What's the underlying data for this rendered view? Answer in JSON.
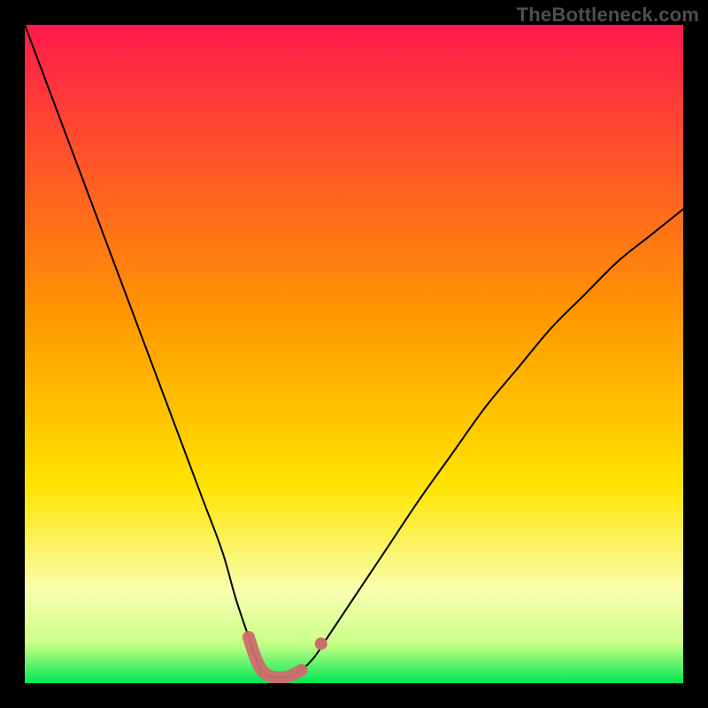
{
  "watermark": "TheBottleneck.com",
  "colors": {
    "frame_bg": "#000000",
    "gradient_top": "#ff1a4b",
    "gradient_mid": "#ffd400",
    "gradient_low": "#f9ffb0",
    "gradient_green": "#00e853",
    "curve_stroke": "#000000",
    "marker_color": "#cf6b6e",
    "watermark_color": "#4e4e4e"
  },
  "chart_data": {
    "type": "line",
    "title": "",
    "xlabel": "",
    "ylabel": "",
    "xlim": [
      0,
      100
    ],
    "ylim": [
      0,
      100
    ],
    "series": [
      {
        "name": "bottleneck-curve",
        "x": [
          0,
          3,
          6,
          9,
          12,
          15,
          18,
          21,
          24,
          27,
          30,
          32,
          34,
          35,
          36,
          37.5,
          40,
          42,
          44,
          46,
          48,
          52,
          56,
          60,
          65,
          70,
          75,
          80,
          85,
          90,
          95,
          100
        ],
        "y": [
          100,
          92,
          84,
          76,
          68,
          60,
          52,
          44,
          36,
          28,
          20,
          13,
          7,
          4,
          2,
          1,
          1,
          2,
          4,
          7,
          10,
          16,
          22,
          28,
          35,
          42,
          48,
          54,
          59,
          64,
          68,
          72
        ]
      }
    ],
    "markers": {
      "name": "highlighted-region",
      "description": "thick rounded segment at curve minimum plus small dot on right slope",
      "color": "#cf6b6e",
      "segment": {
        "x_from": 33.5,
        "x_to": 42,
        "note": "follows curve bottom"
      },
      "dot": {
        "x": 45,
        "y": 6
      }
    },
    "background_gradient": {
      "type": "vertical",
      "stops": [
        {
          "offset": 0.0,
          "color": "#ff1a4b"
        },
        {
          "offset": 0.45,
          "color": "#ff9a00"
        },
        {
          "offset": 0.7,
          "color": "#ffe400"
        },
        {
          "offset": 0.86,
          "color": "#f9ffb0"
        },
        {
          "offset": 0.94,
          "color": "#c9ff87"
        },
        {
          "offset": 1.0,
          "color": "#00e853"
        }
      ]
    }
  }
}
